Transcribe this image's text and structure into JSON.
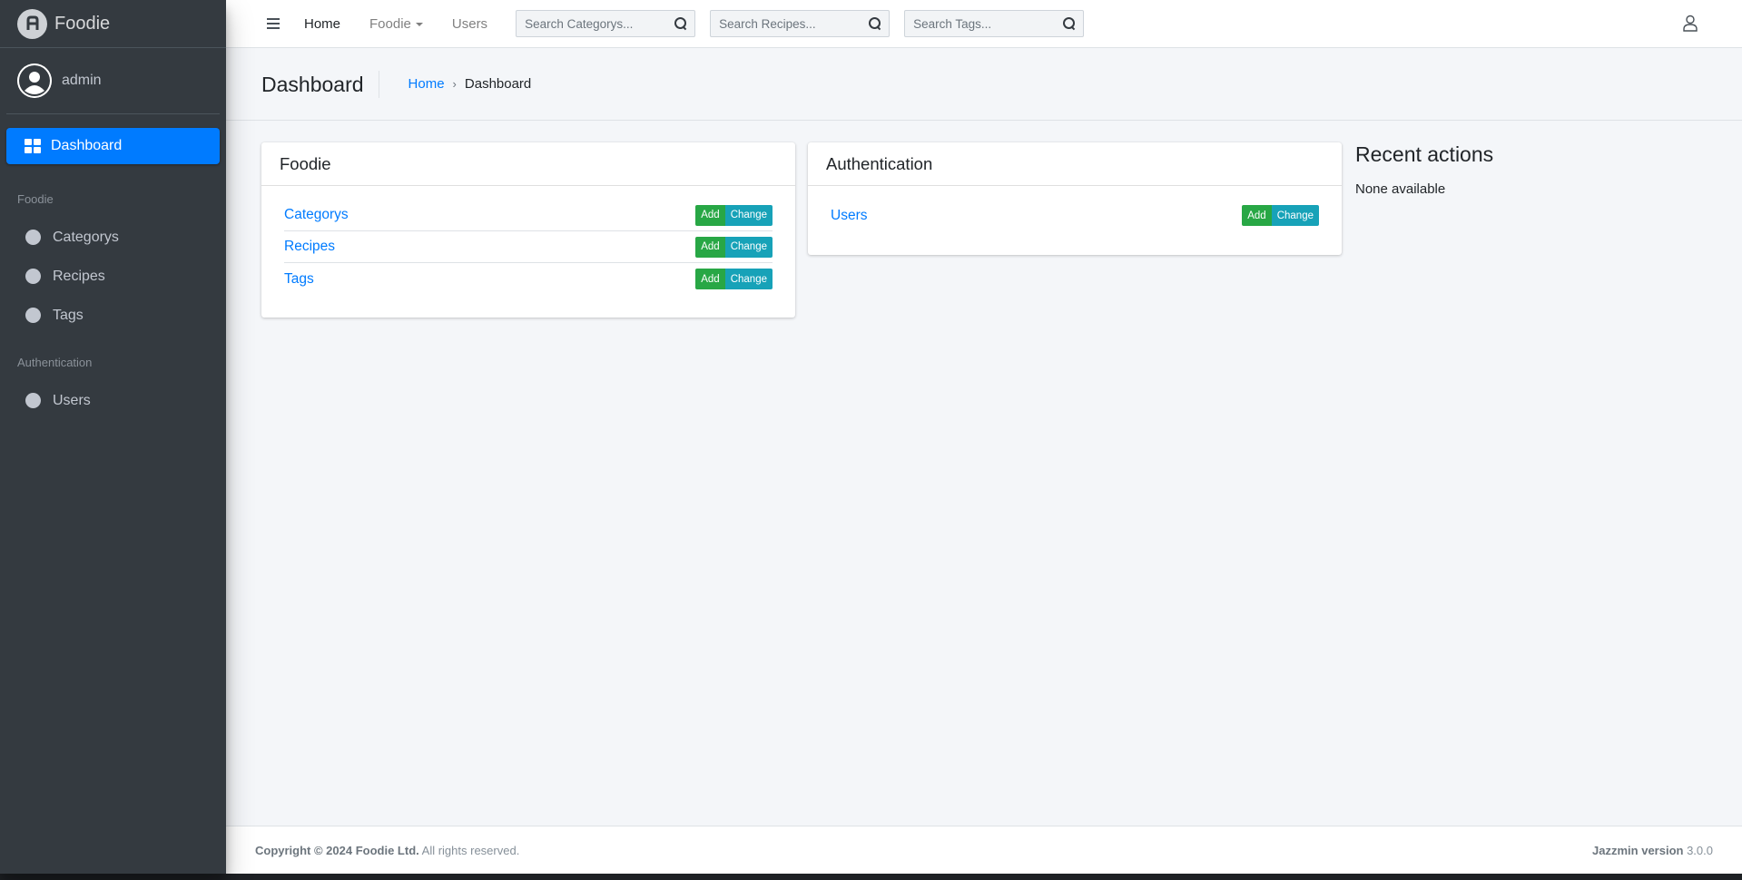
{
  "brand": {
    "name": "Foodie"
  },
  "user": {
    "name": "admin"
  },
  "sidebar": {
    "active": "Dashboard",
    "sections": [
      {
        "header": "Foodie",
        "items": [
          "Categorys",
          "Recipes",
          "Tags"
        ]
      },
      {
        "header": "Authentication",
        "items": [
          "Users"
        ]
      }
    ]
  },
  "topbar": {
    "home": "Home",
    "foodie": "Foodie",
    "users": "Users",
    "search_categorys": "Search Categorys...",
    "search_recipes": "Search Recipes...",
    "search_tags": "Search Tags..."
  },
  "header": {
    "title": "Dashboard",
    "breadcrumb_home": "Home",
    "breadcrumb_current": "Dashboard"
  },
  "apps": [
    {
      "title": "Foodie",
      "models": [
        "Categorys",
        "Recipes",
        "Tags"
      ]
    },
    {
      "title": "Authentication",
      "models": [
        "Users"
      ]
    }
  ],
  "buttons": {
    "add": "Add",
    "change": "Change"
  },
  "recent": {
    "title": "Recent actions",
    "empty": "None available"
  },
  "footer": {
    "copyright_bold": "Copyright © 2024 Foodie Ltd.",
    "copyright_rest": " All rights reserved.",
    "version_label": "Jazzmin version",
    "version_value": " 3.0.0"
  },
  "colors": {
    "primary": "#007bff",
    "add": "#28a745",
    "change": "#17a2b8",
    "sidebar": "#343a40"
  }
}
